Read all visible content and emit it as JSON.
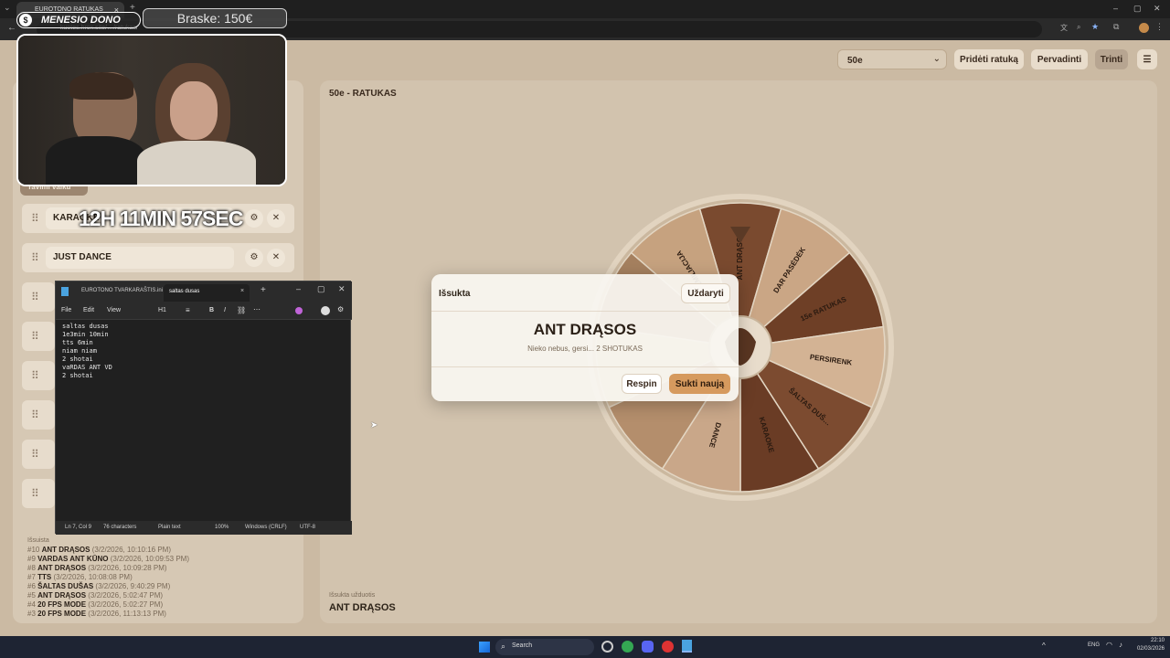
{
  "browser": {
    "tab1": "EUROTONO RATUKAS",
    "url": "kuotes.hrox.site/…/ratukas/",
    "tab_close": "×",
    "new_tab": "+"
  },
  "overlay": {
    "donation_title": "MENESIO DONO",
    "donation_amount": "Braske: 150€",
    "timer": "12H 11MIN 57SEC"
  },
  "toolbar": {
    "wheel_select": "50e",
    "add_wheel": "Pridėti ratuką",
    "rename": "Pervadinti",
    "delete": "Trinti",
    "menu_icon": "☰"
  },
  "sidebar": {
    "section_tab": "Tavimi vaiku",
    "items": [
      {
        "name": "KARAOKE"
      },
      {
        "name": "JUST DANCE"
      }
    ],
    "history_title": "Išsuista",
    "history": [
      {
        "idx": "#10",
        "name": "ANT DRĄSOS",
        "time": "(3/2/2026, 10:10:16 PM)"
      },
      {
        "idx": "#9",
        "name": "VARDAS ANT KŪNO",
        "time": "(3/2/2026, 10:09:53 PM)"
      },
      {
        "idx": "#8",
        "name": "ANT DRĄSOS",
        "time": "(3/2/2026, 10:09:28 PM)"
      },
      {
        "idx": "#7",
        "name": "TTS",
        "time": "(3/2/2026, 10:08:08 PM)"
      },
      {
        "idx": "#6",
        "name": "ŠALTAS DUŠAS",
        "time": "(3/2/2026, 9:40:29 PM)"
      },
      {
        "idx": "#5",
        "name": "ANT DRĄSOS",
        "time": "(3/2/2026, 5:02:47 PM)"
      },
      {
        "idx": "#4",
        "name": "20 FPS MODE",
        "time": "(3/2/2026, 5:02:27 PM)"
      },
      {
        "idx": "#3",
        "name": "20 FPS MODE",
        "time": "(3/2/2026, 11:13:13 PM)"
      }
    ]
  },
  "main": {
    "title": "50e - RATUKAS",
    "result_label": "Išsukta užduotis",
    "result_value": "ANT DRĄSOS"
  },
  "wheel": {
    "segments": [
      "ANT DRĄSOS",
      "DAR PASĖDĖK",
      "15e RATUKAS",
      "PERSIRENK",
      "ŠALTAS DUŠ…",
      "KARAOKE",
      "DANCE",
      "",
      "",
      "",
      "FEMILIACIJA"
    ],
    "segment_colors": [
      "#7a4a2f",
      "#caa685",
      "#6e3f26",
      "#d3b394",
      "#7c4b30",
      "#6a3c25",
      "#c9a789",
      "#b48e6c",
      "#d6bd9f",
      "#a5805f",
      "#c6a27f"
    ]
  },
  "modal": {
    "title": "Išsukta",
    "close": "Uždaryti",
    "result": "ANT DRĄSOS",
    "subtitle": "Nieko nebus, gersi... 2 SHOTUKAS",
    "respin": "Respin",
    "spin_new": "Sukti naują"
  },
  "notepad": {
    "tab1": "EUROTONO TVARKARAŠTIS.ini",
    "tab2": "saltas dusas",
    "menu": [
      "File",
      "Edit",
      "View"
    ],
    "heading": "H1",
    "bold": "B",
    "italic": "I",
    "lines": [
      "saltas dusas",
      "1e3min 10min",
      "tts 6min",
      "niam niam",
      "2 shotai",
      "vaRDAS ANT VD",
      "2 shotai"
    ],
    "status": {
      "position": "Ln 7, Col 9",
      "chars": "76 characters",
      "format": "Plain text",
      "zoom": "100%",
      "eol": "Windows (CRLF)",
      "encoding": "UTF-8"
    }
  },
  "taskbar": {
    "search": "Search",
    "lang": "ENG",
    "time": "22:10",
    "date": "02/03/2026"
  }
}
